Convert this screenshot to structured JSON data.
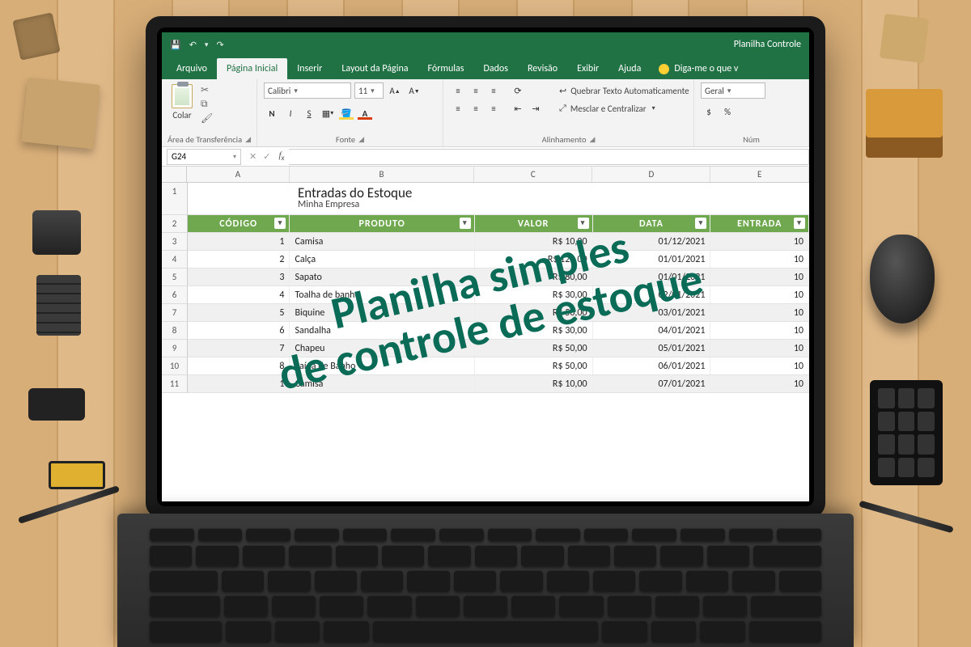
{
  "app": {
    "doc_title": "Planilha Controle"
  },
  "qat": {
    "save": "💾",
    "undo": "↶",
    "redo": "↷"
  },
  "menu": {
    "arquivo": "Arquivo",
    "pagina_inicial": "Página Inicial",
    "inserir": "Inserir",
    "layout": "Layout da Página",
    "formulas": "Fórmulas",
    "dados": "Dados",
    "revisao": "Revisão",
    "exibir": "Exibir",
    "ajuda": "Ajuda",
    "tell_me": "Diga-me o que v"
  },
  "ribbon": {
    "clipboard": {
      "paste": "Colar",
      "group": "Área de Transferência"
    },
    "font": {
      "name": "Calibri",
      "size": "11",
      "group": "Fonte",
      "bold": "N",
      "italic": "I",
      "underline": "S"
    },
    "alignment": {
      "wrap": "Quebrar Texto Automaticamente",
      "merge": "Mesclar e Centralizar",
      "group": "Alinhamento"
    },
    "number": {
      "format": "Geral",
      "group": "Núm"
    }
  },
  "formula_bar": {
    "name_box": "G24"
  },
  "columns": [
    "A",
    "B",
    "C",
    "D",
    "E"
  ],
  "sheet": {
    "title": "Entradas do Estoque",
    "subtitle": "Minha Empresa",
    "headers": {
      "codigo": "CÓDIGO",
      "produto": "PRODUTO",
      "valor": "VALOR",
      "data": "DATA",
      "entrada": "ENTRADA"
    },
    "rows": [
      {
        "codigo": "1",
        "produto": "Camisa",
        "valor": "R$ 10,00",
        "data": "01/12/2021",
        "entrada": "10"
      },
      {
        "codigo": "2",
        "produto": "Calça",
        "valor": "R$ 120,00",
        "data": "01/01/2021",
        "entrada": "10"
      },
      {
        "codigo": "3",
        "produto": "Sapato",
        "valor": "R$ 80,00",
        "data": "01/01/2021",
        "entrada": "10"
      },
      {
        "codigo": "4",
        "produto": "Toalha de banho",
        "valor": "R$ 30,00",
        "data": "02/01/2021",
        "entrada": "10"
      },
      {
        "codigo": "5",
        "produto": "Biquine",
        "valor": "R$ 50,00",
        "data": "03/01/2021",
        "entrada": "10"
      },
      {
        "codigo": "6",
        "produto": "Sandalha",
        "valor": "R$ 30,00",
        "data": "04/01/2021",
        "entrada": "10"
      },
      {
        "codigo": "7",
        "produto": "Chapeu",
        "valor": "R$ 50,00",
        "data": "05/01/2021",
        "entrada": "10"
      },
      {
        "codigo": "8",
        "produto": "Saída de Banho",
        "valor": "R$ 50,00",
        "data": "06/01/2021",
        "entrada": "10"
      },
      {
        "codigo": "1",
        "produto": "Camisa",
        "valor": "R$ 10,00",
        "data": "07/01/2021",
        "entrada": "10"
      }
    ]
  },
  "overlay": {
    "line1": "Planilha simples",
    "line2": "de controle de estoque"
  }
}
